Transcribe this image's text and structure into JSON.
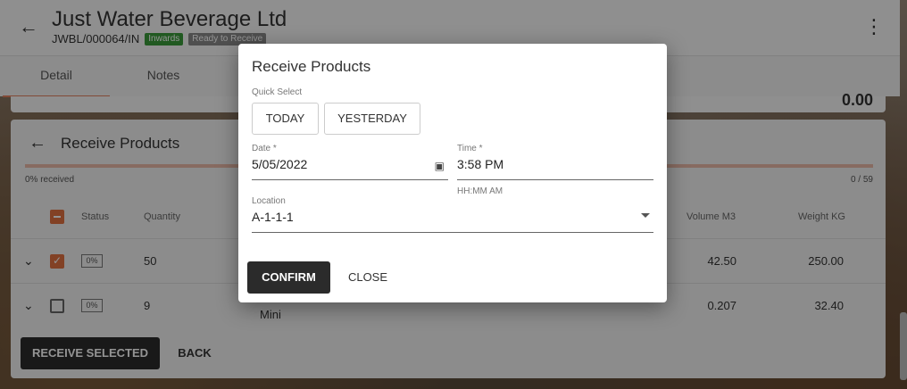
{
  "header": {
    "company_name": "Just Water Beverage Ltd",
    "reference": "JWBL/000064/IN",
    "badge_inwards": "Inwards",
    "badge_status": "Ready to Receive"
  },
  "tabs": [
    {
      "label": "Detail"
    },
    {
      "label": "Notes"
    }
  ],
  "partial_card": {
    "value": "0.00"
  },
  "receive_card": {
    "title": "Receive Products",
    "received_pct": "0% received",
    "received_count": "0 / 59",
    "columns": {
      "status": "Status",
      "quantity": "Quantity",
      "volume": "Volume M3",
      "weight": "Weight KG"
    },
    "rows": [
      {
        "status": "0%",
        "quantity": "50",
        "desc": "",
        "volume": "42.50",
        "weight": "250.00",
        "checked": true
      },
      {
        "status": "0%",
        "quantity": "9",
        "desc": "Mini",
        "volume": "0.207",
        "weight": "32.40",
        "checked": false
      }
    ],
    "receive_selected_label": "RECEIVE SELECTED",
    "back_label": "BACK"
  },
  "dialog": {
    "title": "Receive Products",
    "quick_select_label": "Quick Select",
    "today_label": "TODAY",
    "yesterday_label": "YESTERDAY",
    "date_label": "Date *",
    "date_value": "5/05/2022",
    "time_label": "Time *",
    "time_value": "3:58 PM",
    "time_hint": "HH:MM AM",
    "location_label": "Location",
    "location_value": "A-1-1-1",
    "confirm_label": "CONFIRM",
    "close_label": "CLOSE"
  },
  "icons": {
    "back": "arrow-left-icon",
    "menu": "more-vert-icon",
    "calendar": "calendar-icon",
    "expand": "chevron-down-icon"
  },
  "colors": {
    "accent": "#e07040",
    "dark_button": "#2b2b2b",
    "badge_green": "#3a9a3a"
  }
}
